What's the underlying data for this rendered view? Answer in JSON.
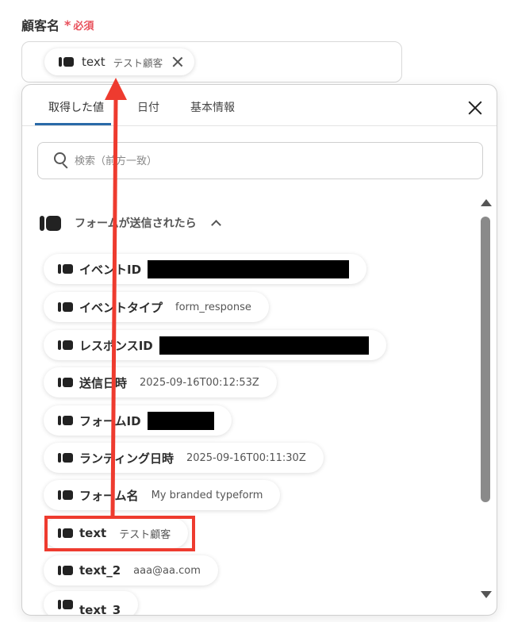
{
  "field": {
    "label": "顧客名",
    "required_star": "*",
    "required_text": "必須",
    "selected": {
      "key": "text",
      "value": "テスト顧客"
    }
  },
  "popup": {
    "tabs": [
      {
        "label": "取得した値"
      },
      {
        "label": "日付"
      },
      {
        "label": "基本情報"
      }
    ],
    "active_tab": "取得した値",
    "search": {
      "placeholder": "検索（前方一致）",
      "value": ""
    },
    "group": {
      "label": "フォームが送信されたら",
      "items": [
        {
          "key": "イベントID",
          "value": ""
        },
        {
          "key": "イベントタイプ",
          "value": "form_response"
        },
        {
          "key": "レスポンスID",
          "value": ""
        },
        {
          "key": "送信日時",
          "value": "2025-09-16T00:12:53Z"
        },
        {
          "key": "フォームID",
          "value": ""
        },
        {
          "key": "ランディング日時",
          "value": "2025-09-16T00:11:30Z"
        },
        {
          "key": "フォーム名",
          "value": "My branded typeform"
        },
        {
          "key": "text",
          "value": "テスト顧客"
        },
        {
          "key": "text_2",
          "value": "aaa@aa.com"
        },
        {
          "key": "text_3",
          "value": ""
        }
      ]
    }
  },
  "colors": {
    "required": "#e8505b",
    "tab_underline": "#2a6aa8",
    "annotation": "#ee3b2f"
  }
}
